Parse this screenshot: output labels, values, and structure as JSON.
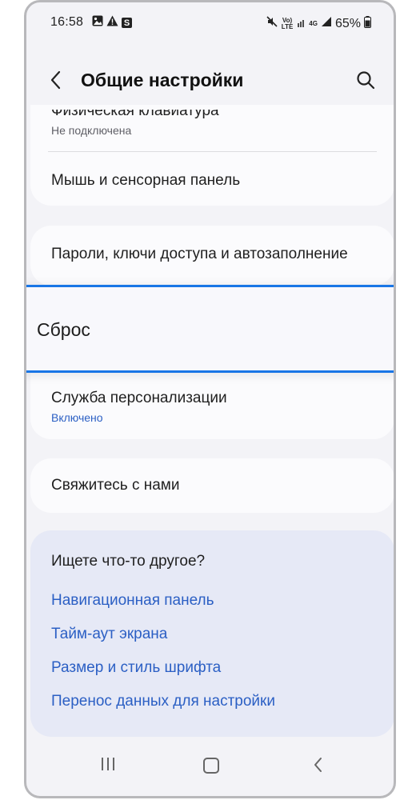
{
  "status_bar": {
    "time": "16:58",
    "signal_label": "Vo)\nLTE",
    "network_label": "4G",
    "battery": "65%"
  },
  "header": {
    "title": "Общие настройки"
  },
  "settings": {
    "physical_keyboard": {
      "title": "Физическая клавиатура",
      "subtitle": "Не подключена"
    },
    "mouse": {
      "title": "Мышь и сенсорная панель"
    },
    "passwords": {
      "title": "Пароли, ключи доступа и автозаполнение"
    },
    "reset": {
      "title": "Сброс"
    },
    "personalization": {
      "title": "Служба персонализации",
      "subtitle": "Включено"
    },
    "contact": {
      "title": "Свяжитесь с нами"
    }
  },
  "suggestions": {
    "heading": "Ищете что-то другое?",
    "links": [
      "Навигационная панель",
      "Тайм-аут экрана",
      "Размер и стиль шрифта",
      "Перенос данных для настройки"
    ]
  },
  "colors": {
    "accent": "#1976e6",
    "link": "#2b5fc4",
    "background": "#f3f3f7",
    "card": "#fbfbfd",
    "suggest_bg": "#e6e9f6"
  },
  "icons": [
    "image-icon",
    "warning-icon",
    "s-app-icon",
    "mute-icon",
    "wifi-icon",
    "signal-icon",
    "battery-icon",
    "back-chevron-icon",
    "search-icon",
    "nav-recents-icon",
    "nav-home-icon",
    "nav-back-icon"
  ]
}
